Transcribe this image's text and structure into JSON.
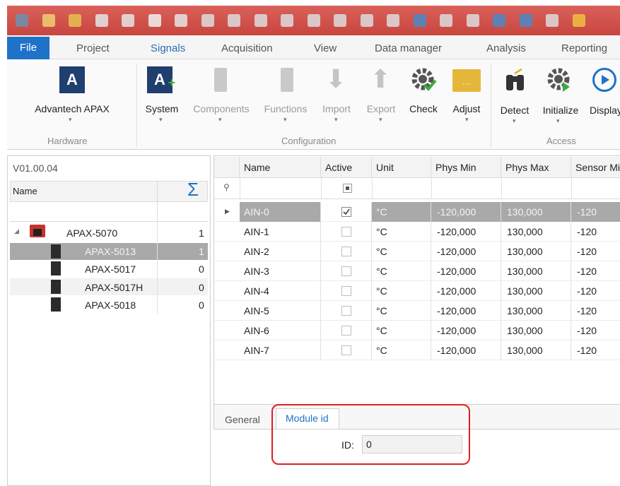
{
  "toolbar": {
    "icons": [
      "app-icon",
      "new-icon",
      "open-icon",
      "save-icon",
      "save-as-icon",
      "auto-icon",
      "print-icon",
      "cut-icon",
      "copy-icon",
      "paste-icon",
      "clipboard-icon",
      "clone-icon",
      "export-icon",
      "delete-icon",
      "tools-icon",
      "undo-icon",
      "redo-icon",
      "settings-icon",
      "wrench-icon",
      "help-icon",
      "chart-icon",
      "hand-icon"
    ]
  },
  "menu": {
    "file": "File",
    "tabs": [
      "Project",
      "Signals",
      "Acquisition",
      "View",
      "Data manager",
      "Analysis",
      "Reporting"
    ],
    "active": "Signals"
  },
  "ribbon": {
    "hardware": {
      "label": "Hardware",
      "advantech": "Advantech APAX"
    },
    "configuration": {
      "label": "Configuration",
      "system": "System",
      "components": "Components",
      "functions": "Functions",
      "import": "Import",
      "export": "Export",
      "check": "Check",
      "adjust": "Adjust"
    },
    "access": {
      "label": "Access",
      "detect": "Detect",
      "initialize": "Initialize",
      "display": "Display"
    },
    "colors": {
      "accent": "#1e72c8",
      "brand_dark": "#1f3f6e",
      "check_green": "#3cab3c",
      "folder_yellow": "#e4b73a"
    }
  },
  "left_panel": {
    "version": "V01.00.04",
    "col_name": "Name",
    "sum_symbol": "Σ",
    "tree": [
      {
        "name": "APAX-5070",
        "count": "1"
      },
      {
        "name": "APAX-5013",
        "count": "1"
      },
      {
        "name": "APAX-5017",
        "count": "0"
      },
      {
        "name": "APAX-5017H",
        "count": "0"
      },
      {
        "name": "APAX-5018",
        "count": "0"
      }
    ]
  },
  "grid": {
    "headers": [
      "Name",
      "Active",
      "Unit",
      "Phys Min",
      "Phys Max",
      "Sensor Mi"
    ],
    "rows": [
      {
        "name": "AIN-0",
        "active": true,
        "unit": "°C",
        "pmin": "-120,000",
        "pmax": "130,000",
        "smin": "-120"
      },
      {
        "name": "AIN-1",
        "active": false,
        "unit": "°C",
        "pmin": "-120,000",
        "pmax": "130,000",
        "smin": "-120"
      },
      {
        "name": "AIN-2",
        "active": false,
        "unit": "°C",
        "pmin": "-120,000",
        "pmax": "130,000",
        "smin": "-120"
      },
      {
        "name": "AIN-3",
        "active": false,
        "unit": "°C",
        "pmin": "-120,000",
        "pmax": "130,000",
        "smin": "-120"
      },
      {
        "name": "AIN-4",
        "active": false,
        "unit": "°C",
        "pmin": "-120,000",
        "pmax": "130,000",
        "smin": "-120"
      },
      {
        "name": "AIN-5",
        "active": false,
        "unit": "°C",
        "pmin": "-120,000",
        "pmax": "130,000",
        "smin": "-120"
      },
      {
        "name": "AIN-6",
        "active": false,
        "unit": "°C",
        "pmin": "-120,000",
        "pmax": "130,000",
        "smin": "-120"
      },
      {
        "name": "AIN-7",
        "active": false,
        "unit": "°C",
        "pmin": "-120,000",
        "pmax": "130,000",
        "smin": "-120"
      }
    ]
  },
  "bottom": {
    "tabs": [
      "General",
      "Module id"
    ],
    "active_tab": "Module id",
    "id_label": "ID:",
    "id_value": "0",
    "highlight_color": "#e02020"
  }
}
